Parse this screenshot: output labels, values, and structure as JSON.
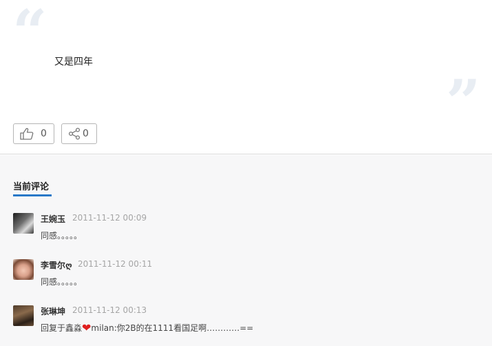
{
  "post": {
    "text": "又是四年",
    "like_count": "0",
    "share_count": "0"
  },
  "comments_section": {
    "title": "当前评论",
    "accent_color": "#2878c8",
    "items": [
      {
        "name": "王婉玉",
        "time": "2011-11-12 00:09",
        "text": "同感。。。。。"
      },
      {
        "name": "李雪尔ღ",
        "time": "2011-11-12 00:11",
        "text": "同感。。。。。"
      },
      {
        "name": "张琳坤",
        "time": "2011-11-12 00:13",
        "text_before": "回复于鑫淼",
        "heart": "❤",
        "text_after": "milan:你2B的在1111看国足啊…………==",
        "avatar_icon": "user-avatar"
      }
    ]
  }
}
